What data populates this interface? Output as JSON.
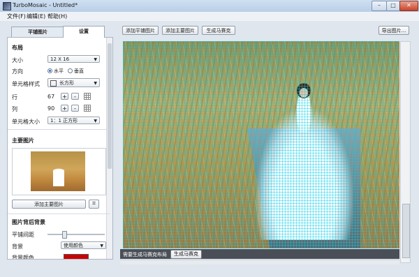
{
  "window": {
    "title": "TurboMosaic - Untitled*",
    "min": "–",
    "max": "□",
    "close": "✕"
  },
  "menu": [
    "文件(F)",
    "编辑(E)",
    "帮助(H)"
  ],
  "tabs": [
    "平铺图片",
    "设置"
  ],
  "layout": {
    "section": "布局",
    "size_label": "大小",
    "size_value": "12 X 16",
    "orientation_label": "方向",
    "orientation_options": [
      "水平",
      "垂直"
    ],
    "orientation_selected": "水平",
    "cell_style_label": "单元格样式",
    "cell_style_value": "长方形",
    "rows_label": "行",
    "rows_value": "67",
    "cols_label": "列",
    "cols_value": "90",
    "cell_size_label": "单元格大小",
    "cell_size_value": "1：1 正方形",
    "plus": "+",
    "minus": "-"
  },
  "main_image": {
    "section": "主要图片",
    "add_button": "添加主要图片",
    "crop_icon": "crop-icon"
  },
  "background": {
    "section": "图片背后背景",
    "tile_spacing_label": "平铺间距",
    "bg_label": "背景",
    "bg_value": "使用颜色",
    "bg_color_label": "背景颜色",
    "bg_color": "#cc0000"
  },
  "toolbar": {
    "add_tiles": "添加平铺图片",
    "add_main": "添加主要图片",
    "generate": "生成马赛克",
    "export": "导出图片..."
  },
  "status": {
    "text": "需要生成马赛克布局",
    "button": "生成马赛克"
  },
  "colors": {
    "grid": "#00d2e6",
    "titlebar": "#b9cfe6"
  }
}
